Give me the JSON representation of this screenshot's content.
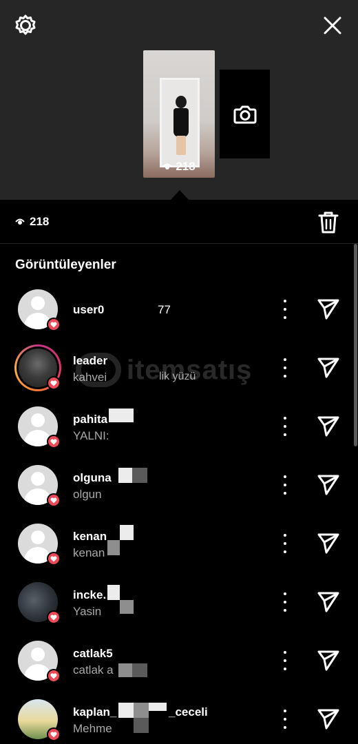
{
  "story": {
    "thumbnail_view_count": "218",
    "view_count": "218"
  },
  "viewers_heading": "Görüntüleyenler",
  "viewers": [
    {
      "username": "user0",
      "extra": "77",
      "subtitle": "",
      "liked": true,
      "avatar": "placeholder"
    },
    {
      "username": "leader",
      "extra": "",
      "subtitle": "kahvei",
      "subtitle_tail": "lik yüzü",
      "liked": true,
      "avatar": "photo-ring"
    },
    {
      "username": "pahita",
      "subtitle": "YALNI:",
      "liked": true,
      "avatar": "placeholder"
    },
    {
      "username": "olguna",
      "subtitle": "olgun",
      "liked": true,
      "avatar": "placeholder"
    },
    {
      "username": "kenan",
      "subtitle": "kenan",
      "liked": true,
      "avatar": "placeholder"
    },
    {
      "username": "incke.",
      "subtitle": "Yasin",
      "liked": true,
      "avatar": "photo"
    },
    {
      "username": "catlak5",
      "subtitle": "catlak a",
      "liked": true,
      "avatar": "placeholder"
    },
    {
      "username": "kaplan_",
      "username_tail": "_ceceli",
      "subtitle": "Mehme",
      "liked": true,
      "avatar": "photo"
    }
  ],
  "watermark": "itemsatış",
  "colors": {
    "top_bg": "#262626",
    "list_bg": "#000000",
    "heart": "#ed4956",
    "secondary_text": "#a8a8a8"
  },
  "icons": [
    "settings-icon",
    "close-icon",
    "camera-icon",
    "eye-icon",
    "trash-icon",
    "more-icon",
    "send-icon",
    "heart-icon"
  ]
}
